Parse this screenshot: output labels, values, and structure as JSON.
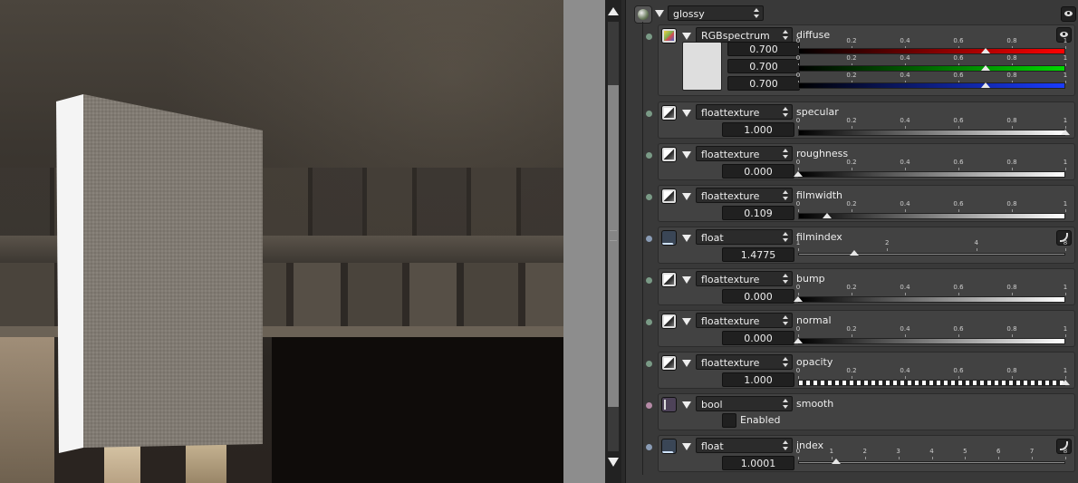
{
  "material": {
    "name": "glossy"
  },
  "diffuse": {
    "type": "RGBspectrum",
    "label": "diffuse",
    "values": [
      "0.700",
      "0.700",
      "0.700"
    ],
    "value_fraction": [
      0.7,
      0.7,
      0.7
    ],
    "scale": [
      "0",
      "0.2",
      "0.4",
      "0.6",
      "0.8",
      "1"
    ],
    "swatch_color": "#dedede"
  },
  "params": [
    {
      "id": "specular",
      "type": "floattexture",
      "label": "specular",
      "value": "1.000",
      "fraction": 1.0,
      "scale": [
        "0",
        "0.2",
        "0.4",
        "0.6",
        "0.8",
        "1"
      ],
      "bar": "gray",
      "icon": "texture-icon",
      "dot_color": "#7a9a86"
    },
    {
      "id": "roughness",
      "type": "floattexture",
      "label": "roughness",
      "value": "0.000",
      "fraction": 0.0,
      "scale": [
        "0",
        "0.2",
        "0.4",
        "0.6",
        "0.8",
        "1"
      ],
      "bar": "gray",
      "icon": "texture-icon",
      "dot_color": "#7a9a86"
    },
    {
      "id": "filmwidth",
      "type": "floattexture",
      "label": "filmwidth",
      "value": "0.109",
      "fraction": 0.109,
      "scale": [
        "0",
        "0.2",
        "0.4",
        "0.6",
        "0.8",
        "1"
      ],
      "bar": "gray",
      "icon": "texture-icon",
      "dot_color": "#7a9a86"
    },
    {
      "id": "filmindex",
      "type": "float",
      "label": "filmindex",
      "value": "1.4775",
      "fraction": 0.211,
      "scale": [
        "1",
        "2",
        "4",
        "8"
      ],
      "scale_pos": [
        0,
        0.333,
        0.667,
        1
      ],
      "bar": "line",
      "icon": "curve-icon",
      "dot_color": "#8a9cb5"
    },
    {
      "id": "bump",
      "type": "floattexture",
      "label": "bump",
      "value": "0.000",
      "fraction": 0.0,
      "scale": [
        "0",
        "0.2",
        "0.4",
        "0.6",
        "0.8",
        "1"
      ],
      "bar": "gray",
      "icon": "texture-icon",
      "dot_color": "#7a9a86"
    },
    {
      "id": "normal",
      "type": "floattexture",
      "label": "normal",
      "value": "0.000",
      "fraction": 0.0,
      "scale": [
        "0",
        "0.2",
        "0.4",
        "0.6",
        "0.8",
        "1"
      ],
      "bar": "gray",
      "icon": "texture-icon",
      "dot_color": "#7a9a86"
    },
    {
      "id": "opacity",
      "type": "floattexture",
      "label": "opacity",
      "value": "1.000",
      "fraction": 1.0,
      "scale": [
        "0",
        "0.2",
        "0.4",
        "0.6",
        "0.8",
        "1"
      ],
      "bar": "check",
      "icon": "texture-icon",
      "dot_color": "#7a9a86"
    },
    {
      "id": "smooth",
      "type": "bool",
      "label": "smooth",
      "checkbox_label": "Enabled",
      "checked": false,
      "icon": "bool-icon",
      "dot_color": "#b58aa6"
    },
    {
      "id": "index",
      "type": "float",
      "label": "index",
      "value": "1.0001",
      "fraction": 0.143,
      "scale": [
        "0",
        "1",
        "2",
        "3",
        "4",
        "5",
        "6",
        "7",
        "8"
      ],
      "bar": "line",
      "icon": "curve-icon",
      "dot_color": "#8a9cb5"
    }
  ]
}
